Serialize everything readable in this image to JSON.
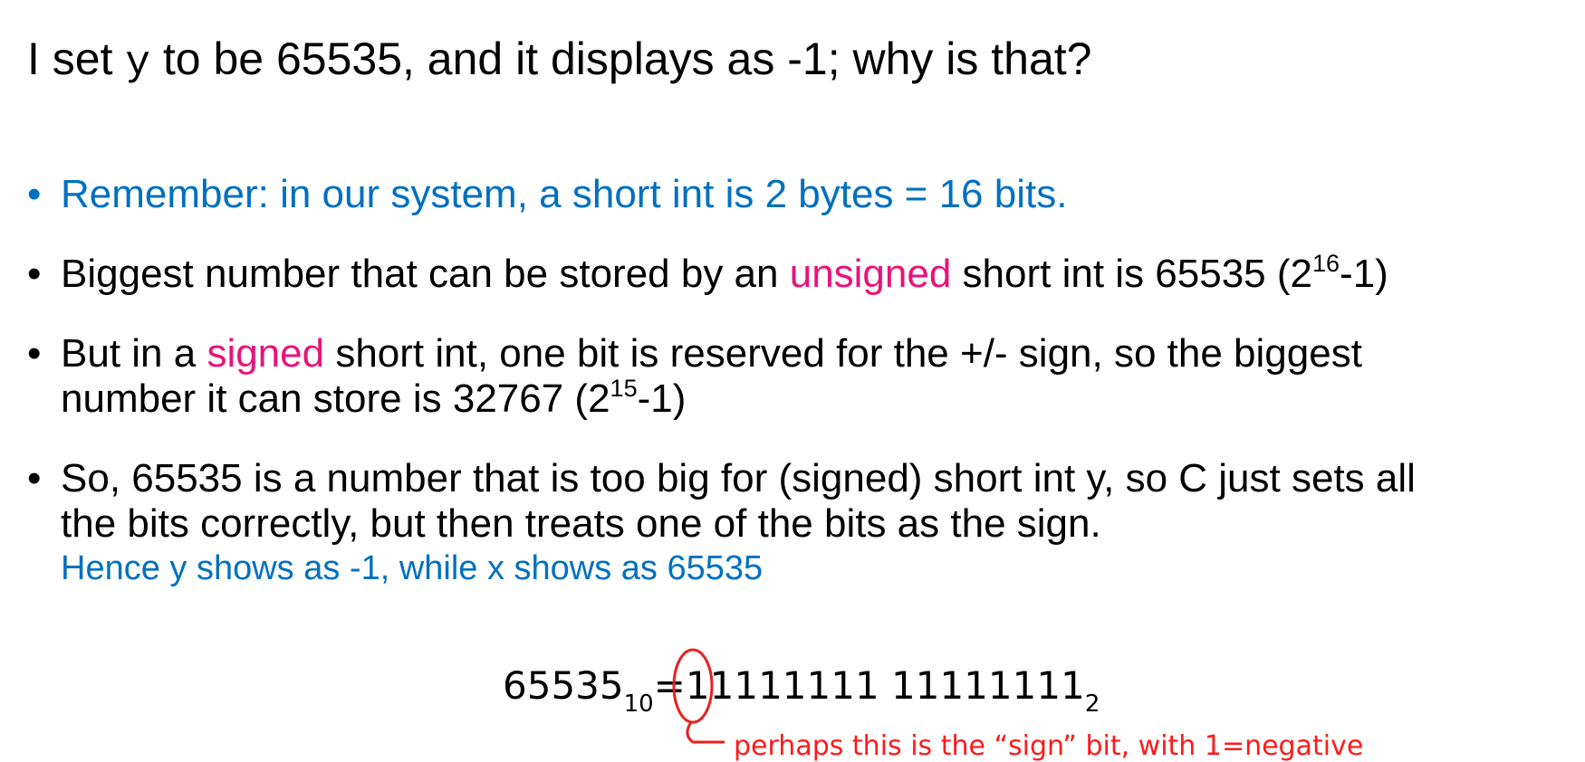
{
  "title": {
    "before": "I set ",
    "code": "y",
    "after": " to be 65535, and it displays as -1; why is that?"
  },
  "bullets": [
    {
      "marker": "•",
      "text": "Remember: in our system, a short int is 2 bytes = 16 bits."
    },
    {
      "marker": "•",
      "before": "Biggest number that can be stored by an ",
      "highlight": "unsigned",
      "after": " short int is 65535 (2",
      "exponent": "16",
      "end": "-1)"
    },
    {
      "marker": "•",
      "before": "But in a ",
      "highlight": "signed",
      "after": " short int, one bit is reserved for the +/- sign, so the biggest",
      "line2_before": "number it can store is 32767 (2",
      "exponent": "15",
      "line2_end": "-1)"
    },
    {
      "marker": "•",
      "line1": "So, 65535 is a number that is too big for (signed) short int y, so C just sets all",
      "line2": "the bits correctly, but then treats one of the bits as the sign.",
      "note": "Hence y shows as -1, while x shows as 65535"
    }
  ],
  "equation": {
    "decimal": "65535",
    "decimal_base": "10",
    "equals": "=",
    "binary": "11111111 11111111",
    "binary_base": "2"
  },
  "annotation": {
    "text": "perhaps this is the “sign” bit, with 1=negative"
  },
  "colors": {
    "blue": "#0070c0",
    "pink": "#e8137a",
    "annotation_red": "#ff1a1a"
  }
}
